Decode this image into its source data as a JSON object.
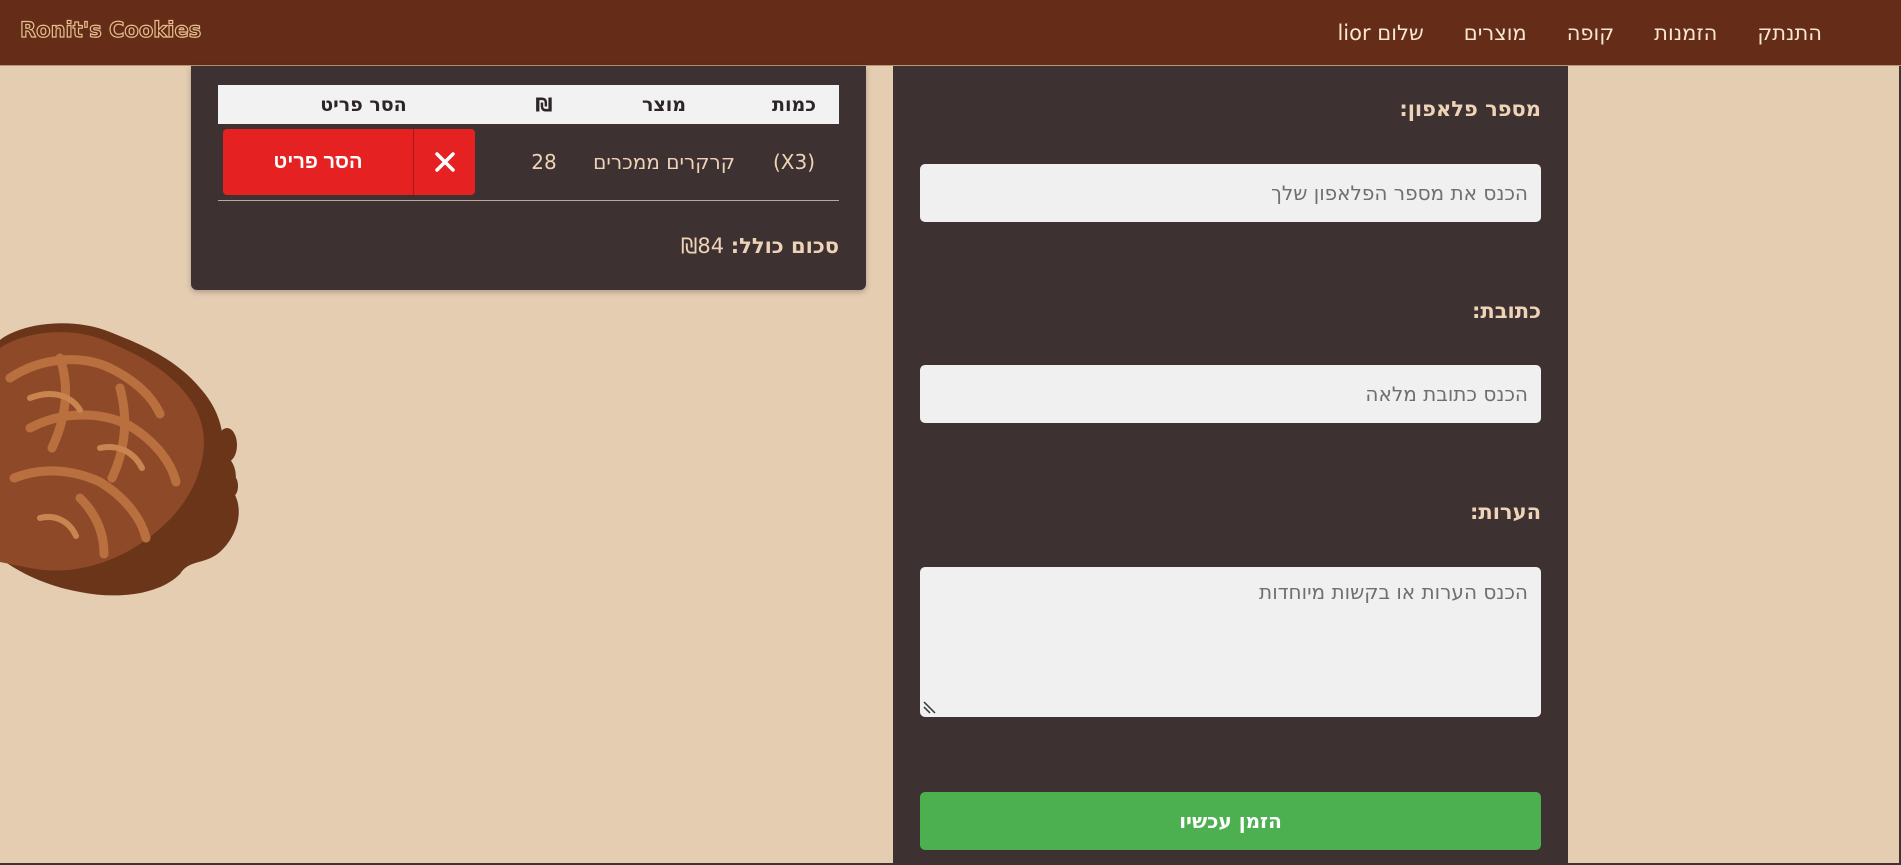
{
  "navbar": {
    "brand": "Ronit's Cookies",
    "links": [
      "התנתק",
      "הזמנות",
      "קופה",
      "מוצרים",
      "שלום lior"
    ]
  },
  "cart": {
    "headers": {
      "qty": "כמות",
      "product": "מוצר",
      "price": "₪",
      "remove": "הסר פריט"
    },
    "rows": [
      {
        "qty": "(X3)",
        "product": "קרקרים ממכרים",
        "price": "28",
        "remove_label": "הסר פריט"
      }
    ],
    "total_label": "סכום כולל:",
    "total_value": "₪84"
  },
  "form": {
    "phone_label": "מספר פלאפון:",
    "phone_placeholder": "הכנס את מספר הפלאפון שלך",
    "address_label": "כתובת:",
    "address_placeholder": "הכנס כתובת מלאה",
    "notes_label": "הערות:",
    "notes_placeholder": "הכנס הערות או בקשות מיוחדות",
    "submit_label": "הזמן עכשיו"
  },
  "colors": {
    "navbar": "#652c18",
    "background": "#e5cdb2",
    "panel": "#3d3132",
    "remove": "#e52121",
    "submit": "#4caf50"
  }
}
